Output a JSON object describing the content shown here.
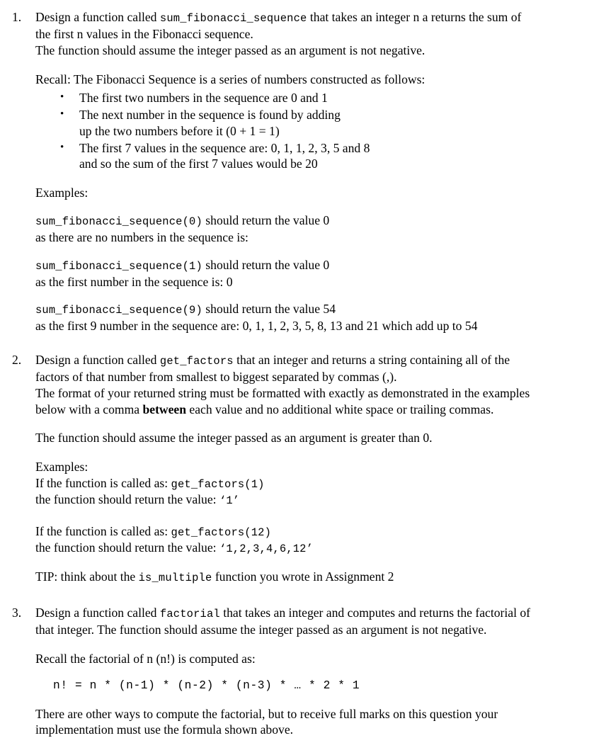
{
  "document": {
    "type": "assignment-questions",
    "background_color": "#ffffff",
    "text_color": "#000000"
  },
  "questions": [
    {
      "number": "1.",
      "intro_prefix": "Design a function called ",
      "intro_code": "sum_fibonacci_sequence",
      "intro_suffix": " that takes an integer n a returns the sum of",
      "intro_line2": "the first n values in the Fibonacci sequence.",
      "intro_line3": "The function should assume the integer passed as an argument is not negative.",
      "recall_heading": "Recall: The Fibonacci Sequence is a series of numbers constructed as follows:",
      "bullet_marker": "•",
      "bullets": [
        {
          "line1": "The first two numbers in the sequence are 0 and 1",
          "line2": ""
        },
        {
          "line1": "The next number in the sequence is found by adding",
          "line2": "up the two numbers before it (0 + 1 = 1)"
        },
        {
          "line1": "The first 7 values in the sequence are:  0, 1, 1, 2, 3, 5 and  8",
          "line2": "and so the sum of the first 7 values would be 20"
        }
      ],
      "examples_label": "Examples:",
      "examples": [
        {
          "call_code": "sum_fibonacci_sequence(0)",
          "call_suffix": " should return the value 0",
          "explanation": "as there are no numbers in the sequence is:"
        },
        {
          "call_code": "sum_fibonacci_sequence(1)",
          "call_suffix": " should return the value 0",
          "explanation": "as the first number in the sequence is: 0"
        },
        {
          "call_code": "sum_fibonacci_sequence(9)",
          "call_suffix": " should return the value 54",
          "explanation": "as the first 9 number in the sequence are:  0, 1, 1, 2, 3, 5, 8, 13 and 21 which add up to 54"
        }
      ]
    },
    {
      "number": "2.",
      "intro_prefix": "Design a function called ",
      "intro_code": "get_factors",
      "intro_suffix": " that an integer and returns a string containing all of the",
      "intro_line2": "factors of that number from smallest to biggest separated by commas (,).",
      "format_line1_a": "The format of your returned string must be formatted with exactly as demonstrated in the examples",
      "format_line2_a": "below with a comma ",
      "format_bold": "between",
      "format_line2_b": " each value and no additional white space or trailing commas.",
      "assume_line": "The function should assume the integer passed as an argument is greater than 0.",
      "examples_label": "Examples:",
      "examples": [
        {
          "called_as_prefix": "If the function is called as: ",
          "called_as_code": "get_factors(1)",
          "returns_prefix": "the function should return the value: ",
          "returns_code": "‘1’"
        },
        {
          "called_as_prefix": "If the function is called as: ",
          "called_as_code": "get_factors(12)",
          "returns_prefix": "the function should return the value: ",
          "returns_code": "‘1,2,3,4,6,12’"
        }
      ],
      "tip_prefix": "TIP: think about the ",
      "tip_code": "is_multiple",
      "tip_suffix": " function you wrote in Assignment 2"
    },
    {
      "number": "3.",
      "intro_prefix": "Design a function called ",
      "intro_code": "factorial",
      "intro_suffix": " that takes an integer and computes and returns the factorial of",
      "intro_line2": "that integer.  The function should assume the integer passed as an argument is not negative.",
      "recall_line": "Recall the factorial of n (n!) is computed as:",
      "formula": "n! = n * (n-1) * (n-2) * (n-3) * … * 2 * 1",
      "closing_line1": "There are other ways to compute the factorial, but to receive full marks on this question your",
      "closing_line2": "implementation must use the formula shown above."
    }
  ]
}
